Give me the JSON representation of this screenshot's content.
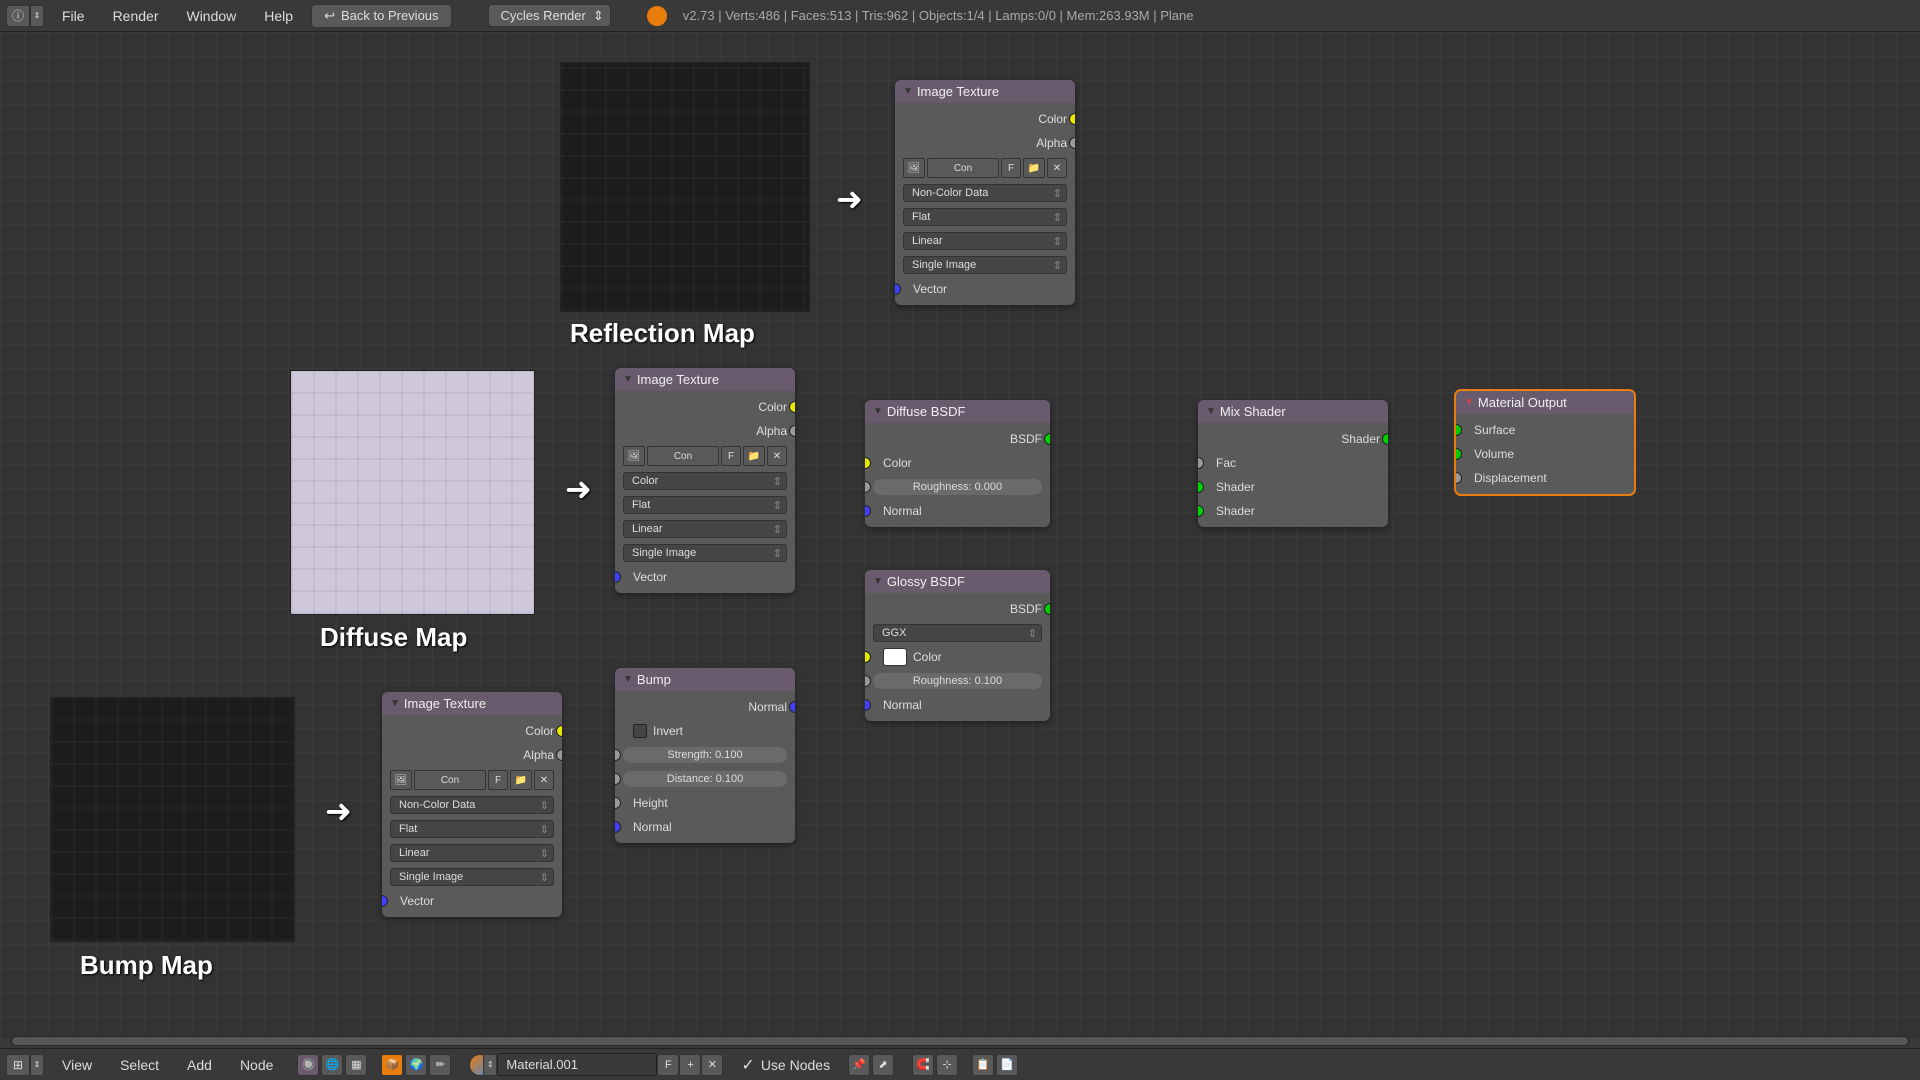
{
  "topbar": {
    "menus": [
      "File",
      "Render",
      "Window",
      "Help"
    ],
    "back_button": "Back to Previous",
    "render_engine": "Cycles Render",
    "stats": "v2.73 | Verts:486 | Faces:513 | Tris:962 | Objects:1/4 | Lamps:0/0 | Mem:263.93M | Plane"
  },
  "labels": {
    "reflection": "Reflection Map",
    "diffuse": "Diffuse Map",
    "bump": "Bump Map"
  },
  "nodes": {
    "imgtex1": {
      "title": "Image Texture",
      "outputs": [
        "Color",
        "Alpha"
      ],
      "btn_con": "Con",
      "btn_f": "F",
      "selects": [
        "Non-Color Data",
        "Flat",
        "Linear",
        "Single Image"
      ],
      "input": "Vector"
    },
    "imgtex2": {
      "title": "Image Texture",
      "outputs": [
        "Color",
        "Alpha"
      ],
      "btn_con": "Con",
      "btn_f": "F",
      "selects": [
        "Color",
        "Flat",
        "Linear",
        "Single Image"
      ],
      "input": "Vector"
    },
    "imgtex3": {
      "title": "Image Texture",
      "outputs": [
        "Color",
        "Alpha"
      ],
      "btn_con": "Con",
      "btn_f": "F",
      "selects": [
        "Non-Color Data",
        "Flat",
        "Linear",
        "Single Image"
      ],
      "input": "Vector"
    },
    "bump": {
      "title": "Bump",
      "output": "Normal",
      "invert": "Invert",
      "strength": "Strength: 0.100",
      "distance": "Distance: 0.100",
      "inputs": [
        "Height",
        "Normal"
      ]
    },
    "diffuse": {
      "title": "Diffuse BSDF",
      "output": "BSDF",
      "inputs": [
        "Color",
        "Normal"
      ],
      "roughness": "Roughness: 0.000"
    },
    "glossy": {
      "title": "Glossy BSDF",
      "output": "BSDF",
      "dist": "GGX",
      "color_label": "Color",
      "roughness": "Roughness: 0.100",
      "normal": "Normal"
    },
    "mix": {
      "title": "Mix Shader",
      "output": "Shader",
      "inputs": [
        "Fac",
        "Shader",
        "Shader"
      ]
    },
    "output": {
      "title": "Material Output",
      "inputs": [
        "Surface",
        "Volume",
        "Displacement"
      ]
    }
  },
  "bottombar": {
    "menus": [
      "View",
      "Select",
      "Add",
      "Node"
    ],
    "material": "Material.001",
    "btn_f": "F",
    "use_nodes": "Use Nodes"
  }
}
